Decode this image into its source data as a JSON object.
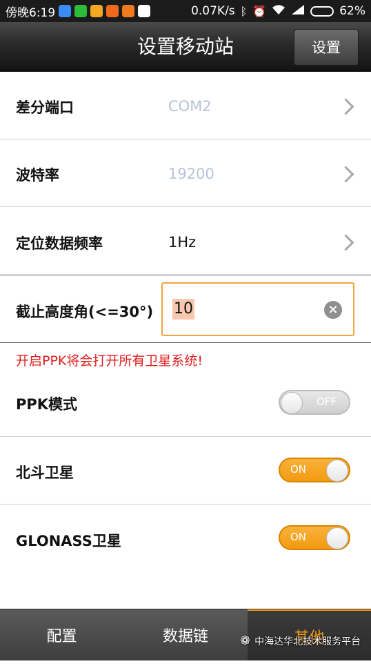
{
  "status_bar": {
    "time": "傍晚6:19",
    "speed": "0.07K/s",
    "battery": "62%",
    "battery_level": 0.62,
    "bluetooth_icon": "bluetooth-icon",
    "alarm_icon": "alarm-icon",
    "wifi_icon": "wifi-icon",
    "signal_icon": "signal-icon"
  },
  "header": {
    "title": "设置移动站",
    "settings_button": "设置"
  },
  "rows": {
    "diff_port": {
      "label": "差分端口",
      "value": "COM2"
    },
    "baud_rate": {
      "label": "波特率",
      "value": "19200"
    },
    "freq": {
      "label": "定位数据频率",
      "value": "1Hz"
    },
    "cutoff": {
      "label": "截止高度角(<=30°)",
      "value": "10"
    }
  },
  "warning": "开启PPK将会打开所有卫星系统!",
  "toggles": {
    "ppk": {
      "label": "PPK模式",
      "state": "OFF"
    },
    "beidou": {
      "label": "北斗卫星",
      "state": "ON"
    },
    "glonass": {
      "label": "GLONASS卫星",
      "state": "ON"
    }
  },
  "tabs": [
    "配置",
    "数据链",
    "其他"
  ],
  "watermark": "中海达华北技术服务平台",
  "colors": {
    "accent": "#f39a12",
    "warning": "#e01d1d",
    "muted_value": "#b7c3d6"
  }
}
